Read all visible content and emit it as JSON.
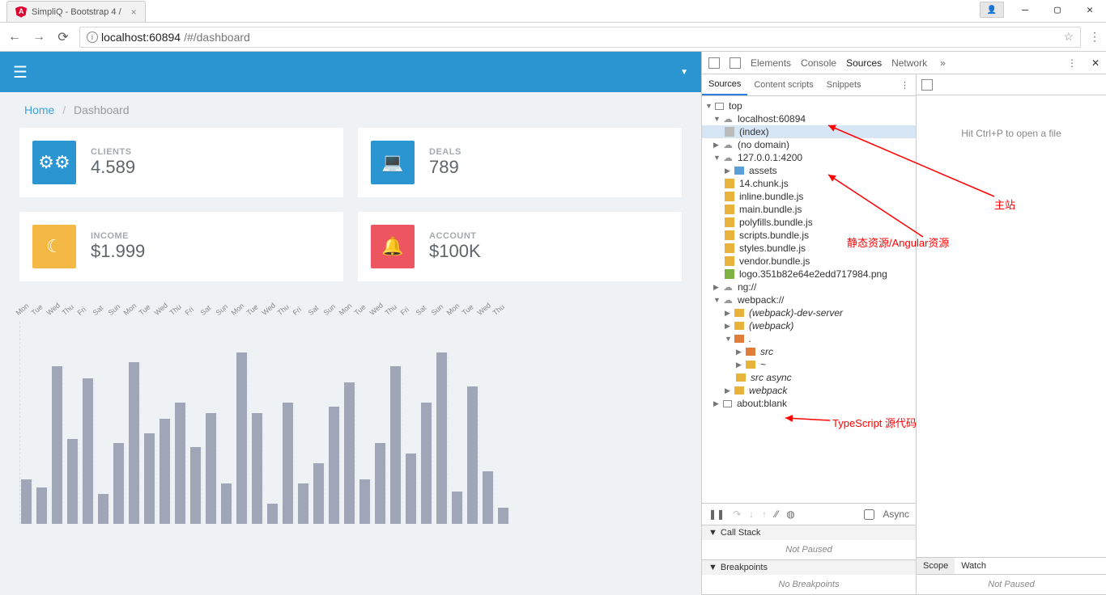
{
  "browser": {
    "tab_title": "SimpliQ - Bootstrap 4 /",
    "url_host": "localhost:60894",
    "url_path": "/#/dashboard"
  },
  "app": {
    "breadcrumb_home": "Home",
    "breadcrumb_current": "Dashboard"
  },
  "cards": {
    "clients_label": "CLIENTS",
    "clients_value": "4.589",
    "deals_label": "DEALS",
    "deals_value": "789",
    "income_label": "INCOME",
    "income_value": "$1.999",
    "account_label": "ACCOUNT",
    "account_value": "$100K"
  },
  "chart_data": {
    "type": "bar",
    "categories": [
      "Mon",
      "Tue",
      "Wed",
      "Thu",
      "Fri",
      "Sat",
      "Sun",
      "Mon",
      "Tue",
      "Wed",
      "Thu",
      "Fri",
      "Sat",
      "Sun",
      "Mon",
      "Tue",
      "Wed",
      "Thu",
      "Fri",
      "Sat",
      "Sun",
      "Mon",
      "Tue",
      "Wed",
      "Thu",
      "Fri",
      "Sat",
      "Sun",
      "Mon",
      "Tue",
      "Wed",
      "Thu"
    ],
    "values": [
      22,
      18,
      78,
      42,
      72,
      15,
      40,
      80,
      45,
      52,
      60,
      38,
      55,
      20,
      85,
      55,
      10,
      60,
      20,
      30,
      58,
      70,
      22,
      40,
      78,
      35,
      60,
      85,
      16,
      68,
      26,
      8
    ],
    "ylim": [
      0,
      100
    ]
  },
  "devtools": {
    "tabs": {
      "elements": "Elements",
      "console": "Console",
      "sources": "Sources",
      "network": "Network"
    },
    "subtabs": {
      "sources": "Sources",
      "content": "Content scripts",
      "snippets": "Snippets"
    },
    "editor_hint": "Hit Ctrl+P to open a file",
    "tree": {
      "top": "top",
      "host": "localhost:60894",
      "index": "(index)",
      "nodomain": "(no domain)",
      "dev_host": "127.0.0.1:4200",
      "assets": "assets",
      "files": {
        "f14": "14.chunk.js",
        "inline": "inline.bundle.js",
        "main": "main.bundle.js",
        "polyfills": "polyfills.bundle.js",
        "scripts": "scripts.bundle.js",
        "styles": "styles.bundle.js",
        "vendor": "vendor.bundle.js",
        "logo": "logo.351b82e64e2edd717984.png"
      },
      "ng": "ng://",
      "webpack": "webpack://",
      "wds": "(webpack)-dev-server",
      "wp": "(webpack)",
      "dot": ".",
      "src": "src",
      "tilde": "~",
      "srcasync": "src async",
      "wpf": "webpack",
      "about": "about:blank"
    },
    "debug": {
      "async_label": "Async"
    },
    "scope_tab": "Scope",
    "watch_tab": "Watch",
    "not_paused": "Not Paused",
    "callstack": "Call Stack",
    "breakpoints": "Breakpoints",
    "no_breakpoints": "No Breakpoints"
  },
  "annotations": {
    "main_site": "主站",
    "static_assets": "静态资源/Angular资源",
    "ts_source": "TypeScript 源代码"
  }
}
